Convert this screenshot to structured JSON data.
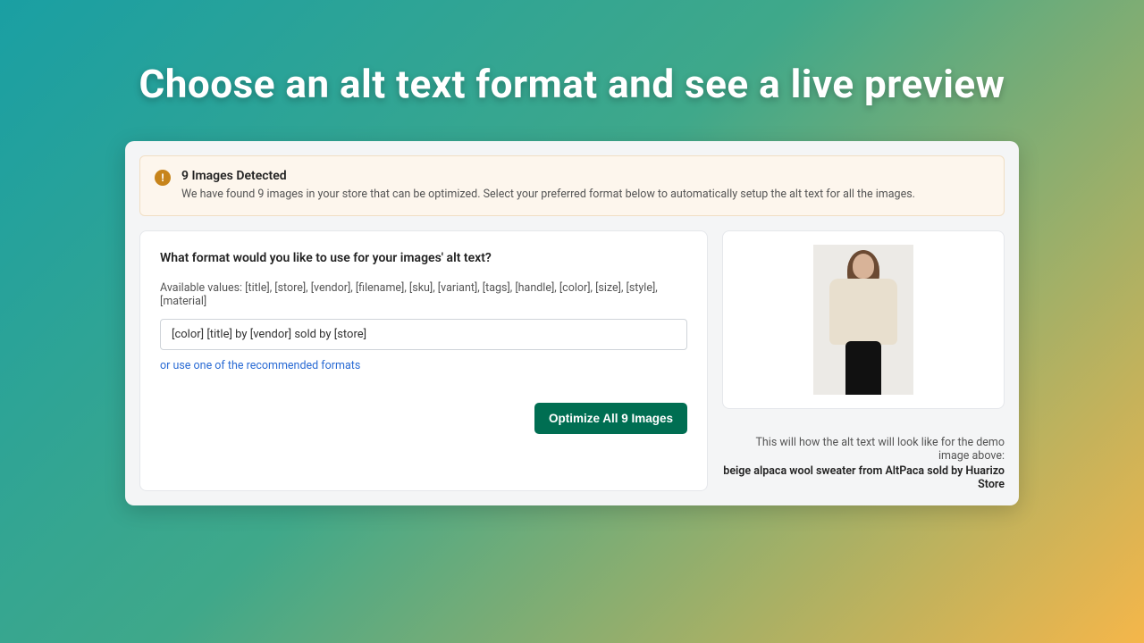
{
  "hero": "Choose an alt text format and see a live preview",
  "banner": {
    "title": "9 Images Detected",
    "body": "We have found 9 images in your store that can be optimized. Select your preferred format below to automatically setup the alt text for all the images."
  },
  "form": {
    "question": "What format would you like to use for your images' alt text?",
    "available": "Available values: [title], [store], [vendor], [filename], [sku], [variant], [tags], [handle], [color], [size], [style], [material]",
    "input_value": "[color] [title] by [vendor] sold by [store]",
    "recommended_link": "or use one of the recommended formats",
    "optimize_button": "Optimize All 9 Images"
  },
  "preview": {
    "caption_lead": "This will how the alt text will look like for the demo image above:",
    "caption_sample": "beige alpaca wool sweater from AltPaca sold by Huarizo Store"
  }
}
